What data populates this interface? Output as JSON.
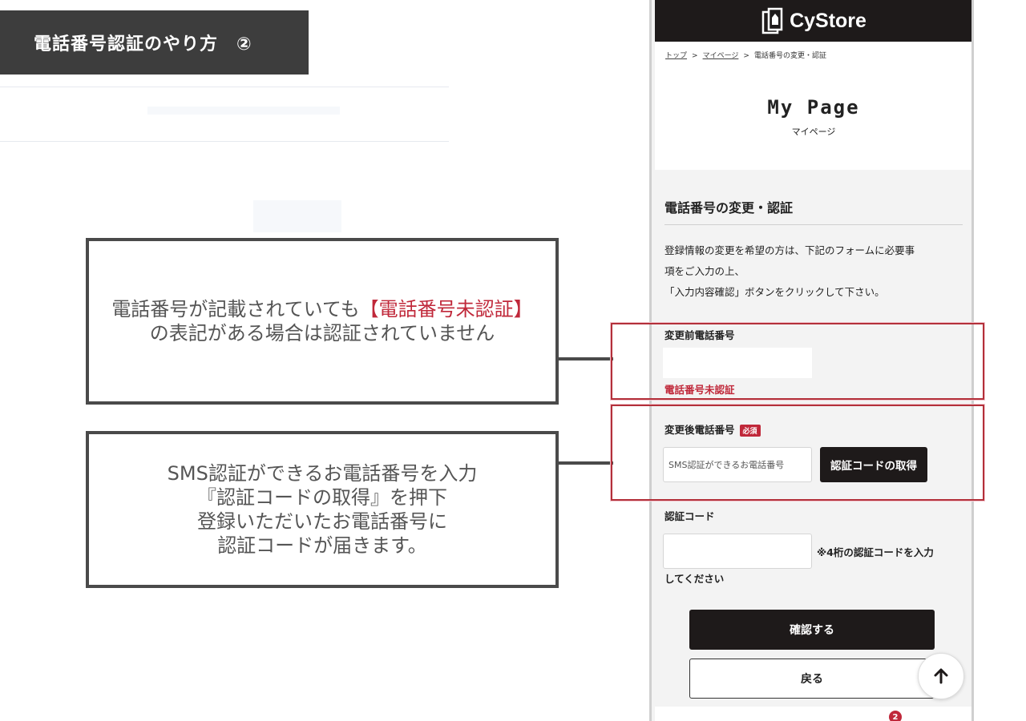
{
  "banner": {
    "title": "電話番号認証のやり方　②"
  },
  "callouts": {
    "first": {
      "line1_prefix": "電話番号が記載されていても",
      "line1_highlight": "【電話番号未認証】",
      "line2": "の表記がある場合は認証されていません"
    },
    "second": {
      "line1": "SMS認証ができるお電話番号を入力",
      "line2": "『認証コードの取得』を押下",
      "line3": "登録いただいたお電話番号に",
      "line4": "認証コードが届きます。"
    }
  },
  "phone": {
    "header": {
      "logo_text": "CyStore"
    },
    "breadcrumb": {
      "top": "トップ",
      "mypage": "マイページ",
      "current": "電話番号の変更・認証",
      "sep": ">"
    },
    "page_title": "My Page",
    "page_subtitle": "マイページ",
    "section_title": "電話番号の変更・認証",
    "description": {
      "line1": "登録情報の変更を希望の方は、下記のフォームに必要事",
      "line2": "項をご入力の上、",
      "line3": "「入力内容確認」ボタンをクリックして下さい。"
    },
    "before_phone": {
      "label": "変更前電話番号",
      "status": "電話番号未認証"
    },
    "after_phone": {
      "label": "変更後電話番号",
      "required": "必須",
      "placeholder": "SMS認証ができるお電話番号",
      "get_code_label": "認証コードの取得"
    },
    "code": {
      "label": "認証コード",
      "note1": "※4桁の認証コードを入力",
      "note2": "してください"
    },
    "confirm_label": "確認する",
    "back_label": "戻る",
    "cart_badge": "2"
  },
  "colors": {
    "accent_red": "#c0283a",
    "dark": "#1e1a1a",
    "banner": "#3d3d3d"
  }
}
